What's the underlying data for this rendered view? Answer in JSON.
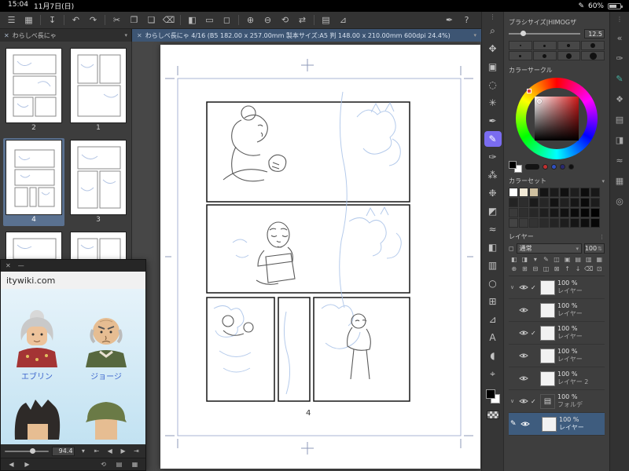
{
  "icons": {
    "close": "✕",
    "caret_down": "▾",
    "caret_up": "▴",
    "check": "✓",
    "minimize": "—",
    "expander": "∨",
    "dots": "⋮",
    "left": "◀",
    "right": "▶",
    "skip_left": "⇤",
    "skip_right": "⇥",
    "list": "▤",
    "grid": "▦",
    "plus": "⊞",
    "refresh": "⟲",
    "pencil": "✎",
    "folder": "▤",
    "square": "◻",
    "updown": "⇅"
  },
  "status_bar": {
    "time": "15:04",
    "date": "11月7日(日)",
    "pencil_icon": "✎",
    "battery_percent": "60%"
  },
  "toolbar": {
    "icons": [
      {
        "name": "menu",
        "glyph": "☰"
      },
      {
        "name": "workspace",
        "glyph": "▦"
      },
      {
        "name": "save",
        "glyph": "↧"
      },
      {
        "name": "undo",
        "glyph": "↶"
      },
      {
        "name": "redo",
        "glyph": "↷"
      },
      {
        "name": "cut",
        "glyph": "✂"
      },
      {
        "name": "copy",
        "glyph": "❐"
      },
      {
        "name": "paste",
        "glyph": "❏"
      },
      {
        "name": "delete",
        "glyph": "⌫"
      },
      {
        "name": "fill",
        "glyph": "◧"
      },
      {
        "name": "select",
        "glyph": "▭"
      },
      {
        "name": "deselect",
        "glyph": "◻"
      },
      {
        "name": "zoom-in",
        "glyph": "⊕"
      },
      {
        "name": "zoom-out",
        "glyph": "⊖"
      },
      {
        "name": "rotate",
        "glyph": "⟲"
      },
      {
        "name": "flip",
        "glyph": "⇄"
      },
      {
        "name": "grid",
        "glyph": "▤"
      },
      {
        "name": "ruler",
        "glyph": "⊿"
      },
      {
        "name": "pen-settings",
        "glyph": "✒"
      },
      {
        "name": "help",
        "glyph": "?"
      }
    ]
  },
  "tabs": {
    "left_title": "わらしべ長にゃ",
    "main_title": "わらしべ長にゃ 4/16 (B5 182.00 x 257.00mm 製本サイズ:A5 判 148.00 x 210.00mm 600dpi 24.4%)"
  },
  "pages": {
    "labels": [
      "2",
      "1",
      "4",
      "3"
    ]
  },
  "canvas": {
    "page_number": "4"
  },
  "subview": {
    "url": "itywiki.com",
    "character_names": [
      "エブリン",
      "ジョージ"
    ],
    "zoom_value": "94.4"
  },
  "tools": {
    "items": [
      {
        "name": "zoom",
        "glyph": "⌕"
      },
      {
        "name": "move",
        "glyph": "✥"
      },
      {
        "name": "operation",
        "glyph": "▣"
      },
      {
        "name": "selection",
        "glyph": "◌"
      },
      {
        "name": "auto-select",
        "glyph": "✳"
      },
      {
        "name": "pen",
        "glyph": "✒"
      },
      {
        "name": "pencil",
        "glyph": "✎"
      },
      {
        "name": "brush",
        "glyph": "✑"
      },
      {
        "name": "airbrush",
        "glyph": "⁂"
      },
      {
        "name": "decoration",
        "glyph": "❉"
      },
      {
        "name": "eraser",
        "glyph": "◩"
      },
      {
        "name": "blend",
        "glyph": "≈"
      },
      {
        "name": "fill",
        "glyph": "◧"
      },
      {
        "name": "gradient",
        "glyph": "▥"
      },
      {
        "name": "figure",
        "glyph": "○"
      },
      {
        "name": "frame",
        "glyph": "⊞"
      },
      {
        "name": "ruler",
        "glyph": "⊿"
      },
      {
        "name": "text",
        "glyph": "A"
      },
      {
        "name": "balloon",
        "glyph": "◖"
      },
      {
        "name": "eyedropper",
        "glyph": "⌖"
      }
    ]
  },
  "right_panel": {
    "brush": {
      "title": "ブラシサイズ|HIMOGザ",
      "value": "12.5"
    },
    "color_circle": {
      "title": "カラーサークル",
      "dot_colors": [
        "#c03030",
        "#3050c0",
        "#282870",
        "#101010"
      ]
    },
    "color_set": {
      "title": "カラーセット",
      "swatches": [
        "#ffffff",
        "#f2e9d6",
        "#cfc0a0",
        "#141414",
        "#1b1b1b",
        "#101010",
        "#1e1e1e",
        "#0d0d0d",
        "#181818",
        "#232323",
        "#2d2d2d",
        "#1a1a1a",
        "#262626",
        "#121212",
        "#202020",
        "#161616",
        "#0a0a0a",
        "#1c1c1c",
        "#3a3a3a",
        "#2f2f2f",
        "#272727",
        "#1f1f1f",
        "#171717",
        "#111111",
        "#0b0b0b",
        "#060606",
        "#020202",
        "#444444",
        "#3c3c3c",
        "#333333",
        "#2b2b2b",
        "#242424",
        "#1d1d1d",
        "#151515",
        "#0e0e0e",
        "#070707"
      ]
    },
    "layers": {
      "title": "レイヤー",
      "blend_mode": "通常",
      "opacity": "100",
      "action_icons_1": [
        "◧",
        "◨",
        "▾",
        "✎",
        "◫",
        "▣",
        "▤",
        "▥",
        "▦"
      ],
      "action_icons_2": [
        "⊕",
        "⊞",
        "⊟",
        "◫",
        "⊠",
        "↑",
        "↓",
        "⌫",
        "⊡"
      ],
      "rows": [
        {
          "opacity": "100 %",
          "name": "レイヤー"
        },
        {
          "opacity": "100 %",
          "name": "レイヤー"
        },
        {
          "opacity": "100 %",
          "name": "レイヤー"
        },
        {
          "opacity": "100 %",
          "name": "レイヤー"
        },
        {
          "opacity": "100 %",
          "name": "レイヤー 2"
        },
        {
          "opacity": "100 %",
          "name": "フォルデ"
        },
        {
          "opacity": "100 %",
          "name": "レイヤー"
        }
      ]
    }
  },
  "far_right": {
    "icons": [
      "«",
      "✑",
      "✎",
      "❖",
      "▤",
      "◨",
      "≈",
      "▦",
      "◎"
    ]
  }
}
